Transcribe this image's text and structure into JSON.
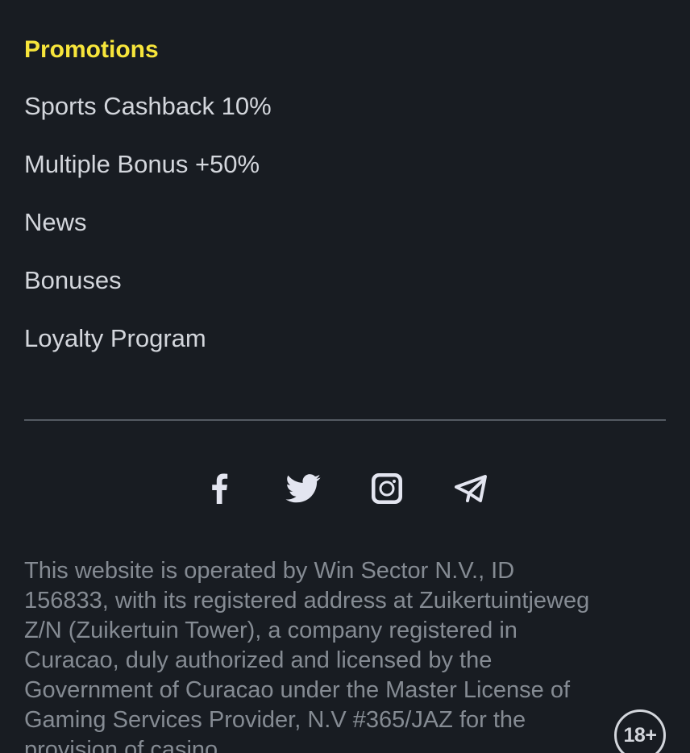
{
  "promotions": {
    "title": "Promotions",
    "items": [
      {
        "label": "Sports Cashback 10%"
      },
      {
        "label": "Multiple Bonus +50%"
      },
      {
        "label": "News"
      },
      {
        "label": "Bonuses"
      },
      {
        "label": "Loyalty Program"
      }
    ]
  },
  "social": {
    "icons": [
      "facebook-icon",
      "twitter-icon",
      "instagram-icon",
      "telegram-icon"
    ],
    "icon_color": "#e3e5f0"
  },
  "legal": {
    "text": "This website is operated by Win Sector N.V., ID 156833, with its registered address at Zuikertuintjeweg Z/N (Zuikertuin Tower), a company registered in Curacao, duly authorized and licensed by the Government of Curacao under the Master License of Gaming Services Provider, N.V #365/JAZ for the provision of casino"
  },
  "age_badge": {
    "label": "18+"
  },
  "colors": {
    "background": "#181c22",
    "accent": "#f7e53b",
    "link": "#d3d6dc",
    "muted": "#858b93",
    "divider": "#545a62"
  }
}
